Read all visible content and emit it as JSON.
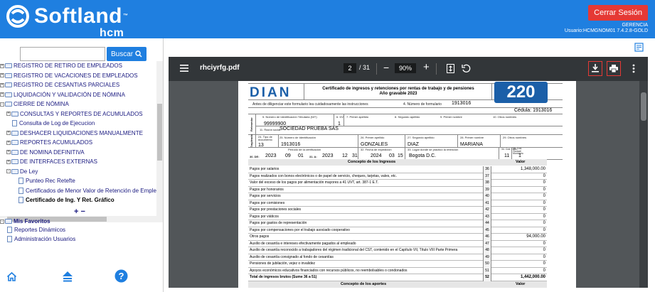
{
  "header": {
    "brand": "Softland",
    "brand_tm": "™",
    "brand_sub": "hcm",
    "logout_label": "Cerrar Sesión",
    "role": "GERENCIA",
    "user": "Usuario:HCMGNOM01 7.4.2.8-GOLD",
    "accent_color": "#1f7fe0",
    "logout_color": "#e53935"
  },
  "sidebar": {
    "search_placeholder": "",
    "search_button": "Buscar",
    "tree": [
      {
        "label": "REGISTRO DE RETIRO DE EMPLEADOS",
        "level": 0,
        "type": "folder",
        "expander": "+"
      },
      {
        "label": "REGISTRO DE VACACIONES DE EMPLEADOS",
        "level": 0,
        "type": "folder",
        "expander": "+"
      },
      {
        "label": "REGISTRO DE CESANTIAS PARCIALES",
        "level": 0,
        "type": "folder",
        "expander": "+"
      },
      {
        "label": "LIQUIDACIÓN Y VALIDACIÓN DE NÓMINA",
        "level": 0,
        "type": "folder",
        "expander": "+"
      },
      {
        "label": "CIERRE DE NÓMINA",
        "level": 0,
        "type": "folder-open",
        "expander": "-"
      },
      {
        "label": "CONSULTAS Y REPORTES DE ACUMULADOS",
        "level": 1,
        "type": "folder",
        "expander": "+"
      },
      {
        "label": "Consulta de Log de Ejecucion",
        "level": 1,
        "type": "doc",
        "expander": ""
      },
      {
        "label": "DESHACER LIQUIDACIONES MANUALMENTE",
        "level": 1,
        "type": "folder",
        "expander": "+"
      },
      {
        "label": "REPORTES ACUMULADOS",
        "level": 1,
        "type": "folder",
        "expander": "+"
      },
      {
        "label": "DE NOMINA DEFINITIVA",
        "level": 1,
        "type": "folder",
        "expander": "+"
      },
      {
        "label": "DE INTERFACES EXTERNAS",
        "level": 1,
        "type": "folder",
        "expander": "+"
      },
      {
        "label": "De Ley",
        "level": 1,
        "type": "folder-open",
        "expander": "-"
      },
      {
        "label": "Punteo Rec Retefte",
        "level": 2,
        "type": "doc",
        "expander": ""
      },
      {
        "label": "Certificados de Menor Valor de Retención de Empleado",
        "level": 2,
        "type": "doc",
        "expander": ""
      },
      {
        "label": "Certificado de Ing. Y Ret. Gráfico",
        "level": 2,
        "type": "doc",
        "expander": "",
        "selected": true
      }
    ],
    "expand_collapse": "+ −",
    "favorites_title": "Mis Favoritos",
    "favorites": [
      "Reportes Dinámicos",
      "Administración Usuarios"
    ]
  },
  "viewer": {
    "filename": "rhciyrfg.pdf",
    "page_current": "2",
    "page_total": "/ 31",
    "zoom": "90%"
  },
  "form": {
    "logo": "DIAN",
    "title_line1": "Certificado de ingresos y retenciones por rentas de trabajo y de pensiones",
    "title_line2": "Año gravable 2023",
    "form_number": "220",
    "note": "Antes de diligenciar este formulario lea cuidadosamente las instrucciones",
    "form_num_label": "4. Número de formulario",
    "form_num_value": "1913016",
    "cedula": "Cédula: 1913016",
    "nit_label": "5. Número de Identificación Tributaria (NIT)",
    "dv_label": "6. DV",
    "ap1_label": "7. Primer apellido",
    "ap2_label": "8. Segundo apellido",
    "n1_label": "9. Primer nombre",
    "n2_label": "10. Otros nombres",
    "nit_value": "99999900",
    "dv_value": "1",
    "retenedor": "Retenedor",
    "razon_label": "11. Razón social",
    "razon_value": "SOCIEDAD  PRUEBA SAS",
    "tipo_label": "24. Tipo de documento",
    "numid_label": "25. Número de Identificación",
    "eap1_label": "26. Primer apellido",
    "eap2_label": "27. Segundo apellido",
    "en1_label": "28. Primer nombre",
    "en2_label": "29. Otros nombres",
    "tipo_value": "13",
    "numid_value": "1913016",
    "eap1_value": "GONZALES",
    "eap2_value": "DIAZ",
    "en1_value": "MARIANA",
    "empleado": "Empleado",
    "periodo_label": "Período de la certificación",
    "fecha_label": "32. Fecha de expedición",
    "lugar_label": "33. Lugar donde se practicó la retención",
    "dpto_label": "34. Cód. Dpto.",
    "mun_label": "35. Cód. Ciudad/ Municipio",
    "de_label": "30. DE:",
    "de_y": "2023",
    "de_m": "09",
    "de_d": "01",
    "a_label": "31. A:",
    "a_y": "2023",
    "a_m": "12",
    "a_d": "31",
    "fe_y": "2024",
    "fe_m": "03",
    "fe_d": "15",
    "lugar_value": "Bogota D.C.",
    "dpto_value": "11",
    "mun_value": "1",
    "concepto_ingresos": "Concepto de los Ingresos",
    "valor_label": "Valor",
    "rows": [
      {
        "label": "Pagos por salarios",
        "num": "36",
        "val": "1,348,000.00"
      },
      {
        "label": "Pagos realizados con bonos electrónicos o de papel de servicio, cheques, tarjetas, vales, etc.",
        "num": "37",
        "val": "0"
      },
      {
        "label": "Valor del exceso de los pagos por alimentación mayores a 41 UVT, art. 387-1 E.T.",
        "num": "38",
        "val": "0"
      },
      {
        "label": "Pagos por honorarios",
        "num": "39",
        "val": "0"
      },
      {
        "label": "Pagos por servicios",
        "num": "40",
        "val": "0"
      },
      {
        "label": "Pagos por comisiones",
        "num": "41",
        "val": "0"
      },
      {
        "label": "Pagos por prestaciones sociales",
        "num": "42",
        "val": "0"
      },
      {
        "label": "Pagos por viáticos",
        "num": "43",
        "val": "0"
      },
      {
        "label": "Pagos por gastos de representación",
        "num": "44",
        "val": "0"
      },
      {
        "label": "Pagos por compensaciones por el trabajo asociado cooperativo",
        "num": "45",
        "val": "0"
      },
      {
        "label": "Otros pagos",
        "num": "46",
        "val": "94,000.00"
      },
      {
        "label": "Auxilio de cesantía e intereses efectivamente pagados al empleado",
        "num": "47",
        "val": "0"
      },
      {
        "label": "Auxilio de cesantía reconocido a trabajadores del régimen tradicional del CST, contenido en el Capítulo VII, Título VIII Parte Primera",
        "num": "48",
        "val": "0"
      },
      {
        "label": "Auxilio de cesantía consignado al fondo de cesantías",
        "num": "49",
        "val": "0"
      },
      {
        "label": "Pensiones de jubilación, vejez o invalidez",
        "num": "50",
        "val": "0"
      },
      {
        "label": "Apoyos económicos educativos financiados con recursos públicos, no reembolsables o condonados",
        "num": "51",
        "val": "0"
      },
      {
        "label": "Total de ingresos brutos (Sume 36 a 51)",
        "num": "52",
        "val": "1,442,000.00",
        "bold": true
      }
    ],
    "concepto_aportes": "Concepto de los aportes",
    "valor_label2": "Valor"
  }
}
